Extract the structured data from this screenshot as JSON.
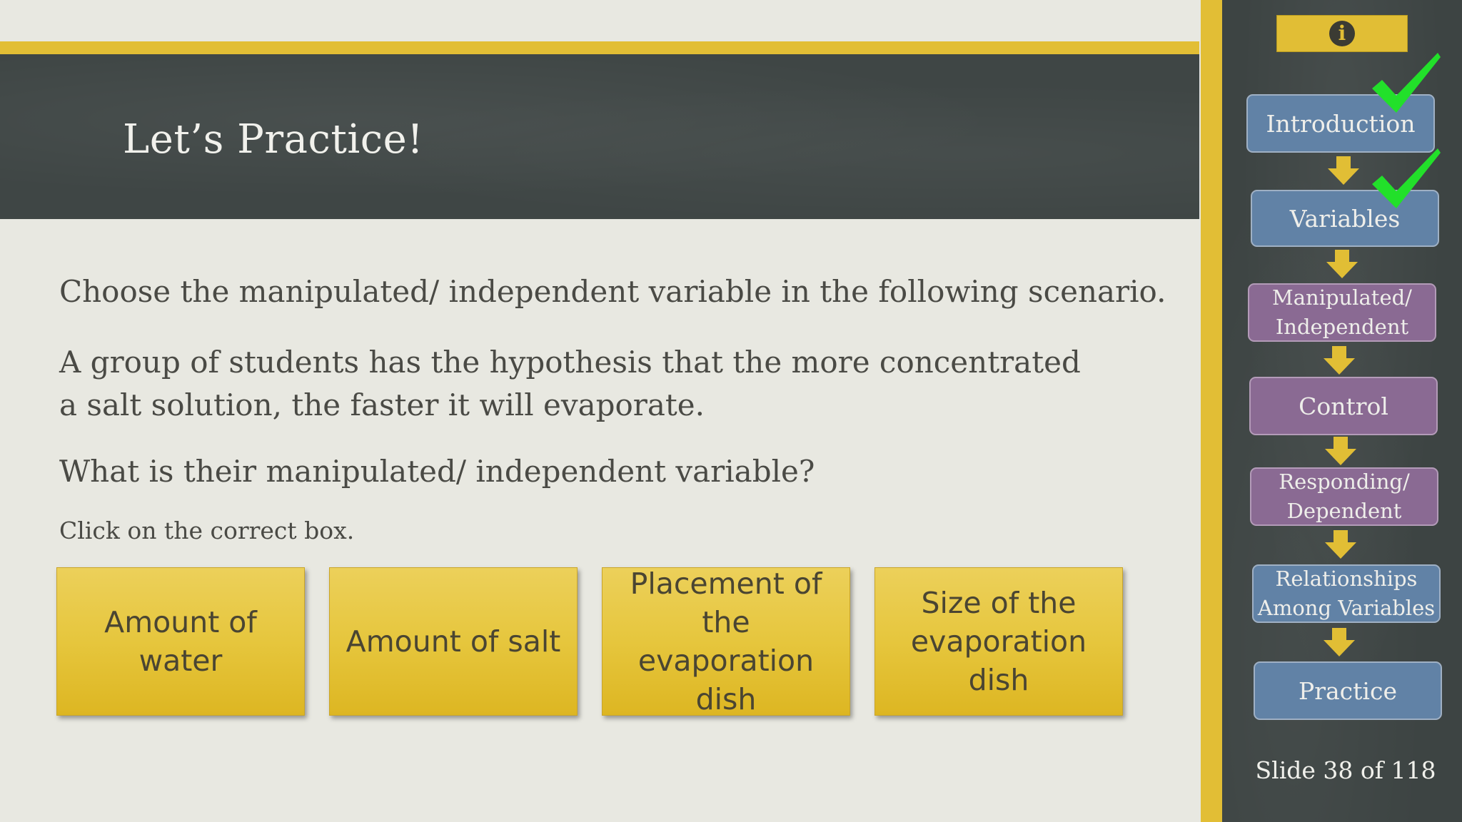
{
  "slide": {
    "title": "Let’s Practice!",
    "instruction": "Choose the manipulated/ independent variable in the following scenario.",
    "scenario": "A group of students has the hypothesis that the more concentrated a salt solution, the faster it will evaporate.",
    "question": "What is their manipulated/ independent variable?",
    "hint": "Click on the correct box."
  },
  "answers": [
    {
      "label": "Amount of water"
    },
    {
      "label": "Amount of salt"
    },
    {
      "label": "Placement of the evaporation dish"
    },
    {
      "label": "Size of the evaporation dish"
    }
  ],
  "sidebar": {
    "info_icon": "info-icon",
    "nav": [
      {
        "label": "Introduction",
        "completed": true
      },
      {
        "label": "Variables",
        "completed": true
      },
      {
        "label": "Manipulated/ Independent",
        "completed": false
      },
      {
        "label": "Control",
        "completed": false
      },
      {
        "label": "Responding/ Dependent",
        "completed": false
      },
      {
        "label": "Relationships Among Variables",
        "completed": false
      },
      {
        "label": "Practice",
        "completed": false
      }
    ],
    "slide_counter": "Slide 38 of 118"
  },
  "colors": {
    "accent_gold": "#e2be35",
    "chalkboard": "#3f4645",
    "nav_blue": "#6182a6",
    "nav_purple": "#8a6a93",
    "check_green": "#22e02a"
  }
}
